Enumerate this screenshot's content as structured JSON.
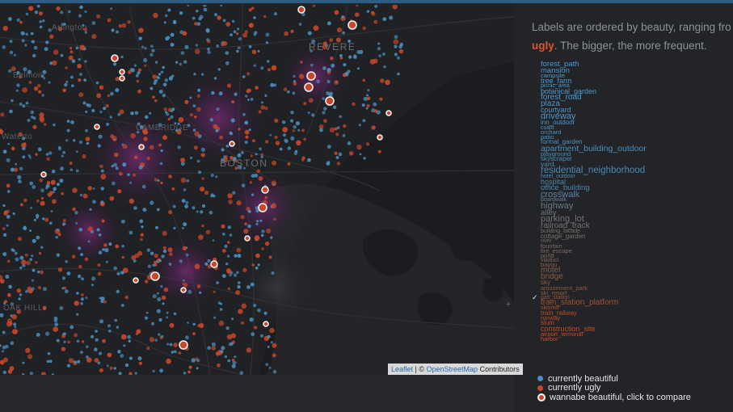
{
  "colors": {
    "beautiful": "#4a90c0",
    "ugly": "#c8472a",
    "wannabe_ring": "#f2f2f2",
    "heat": "#7a2a7a"
  },
  "map": {
    "places": [
      "Arlington",
      "Belmont",
      "Waterto",
      "REVERE",
      "BOSTON",
      "CAMBRIDGE",
      "OAK HILL"
    ],
    "attribution": {
      "leaflet": "Leaflet",
      "separator": " | © ",
      "osm": "OpenStreetMap",
      "suffix": " Contributors"
    },
    "zoom_mark": "+"
  },
  "panel": {
    "intro_line1": "Labels are ordered by beauty, ranging fro",
    "intro_ugly": "ugly",
    "intro_rest": ". The bigger, the more frequent.",
    "checkmark": "✓",
    "labels": [
      {
        "text": "forest_path",
        "size": 9.5,
        "color": "#4b9ad4"
      },
      {
        "text": "mansion",
        "size": 9.5,
        "color": "#4b9ad4"
      },
      {
        "text": "campsite",
        "size": 7.5,
        "color": "#4b9ad4"
      },
      {
        "text": "tree_farm",
        "size": 9,
        "color": "#4b9ad4"
      },
      {
        "text": "picnic_area",
        "size": 7,
        "color": "#4b9ad4"
      },
      {
        "text": "botanical_garden",
        "size": 9,
        "color": "#4b9ad4"
      },
      {
        "text": "forest_road",
        "size": 10,
        "color": "#4b9ad4"
      },
      {
        "text": "plaza",
        "size": 10,
        "color": "#4b96cc"
      },
      {
        "text": "courtyard",
        "size": 9,
        "color": "#4b96cc"
      },
      {
        "text": "driveway",
        "size": 11,
        "color": "#4b96cc"
      },
      {
        "text": "inn_outdoor",
        "size": 8,
        "color": "#4b94c8"
      },
      {
        "text": "coast",
        "size": 7,
        "color": "#4b94c8"
      },
      {
        "text": "orchard",
        "size": 7.5,
        "color": "#4b92c4"
      },
      {
        "text": "patio",
        "size": 7.5,
        "color": "#4b92c4"
      },
      {
        "text": "formal_garden",
        "size": 8,
        "color": "#4b90c0"
      },
      {
        "text": "apartment_building_outdoor",
        "size": 10.5,
        "color": "#4b90c0"
      },
      {
        "text": "playground",
        "size": 7.5,
        "color": "#4b8ebc"
      },
      {
        "text": "skyscraper",
        "size": 8,
        "color": "#4b8ebc"
      },
      {
        "text": "yard",
        "size": 8.5,
        "color": "#4b8cb8"
      },
      {
        "text": "residential_neighborhood",
        "size": 11.5,
        "color": "#4b8ab4"
      },
      {
        "text": "hotel_outdoor",
        "size": 7,
        "color": "#4b88b0"
      },
      {
        "text": "hospital",
        "size": 9,
        "color": "#4b86ac"
      },
      {
        "text": "office_building",
        "size": 9.5,
        "color": "#4b84a8"
      },
      {
        "text": "crosswalk",
        "size": 11,
        "color": "#5a82a0"
      },
      {
        "text": "boardwalk",
        "size": 7,
        "color": "#627e96"
      },
      {
        "text": "highway",
        "size": 11,
        "color": "#6a7a8a"
      },
      {
        "text": "alley",
        "size": 9.5,
        "color": "#707680"
      },
      {
        "text": "parking_lot",
        "size": 11,
        "color": "#747478"
      },
      {
        "text": "railroad_track",
        "size": 10,
        "color": "#767272"
      },
      {
        "text": "building_facade",
        "size": 7,
        "color": "#78706c"
      },
      {
        "text": "cottage_garden",
        "size": 8,
        "color": "#7a6e68"
      },
      {
        "text": "river",
        "size": 7,
        "color": "#7c6c64"
      },
      {
        "text": "fountain",
        "size": 7.5,
        "color": "#7e6a60"
      },
      {
        "text": "fire_escape",
        "size": 7.5,
        "color": "#80685c"
      },
      {
        "text": "pond",
        "size": 7.5,
        "color": "#826658"
      },
      {
        "text": "viaduct",
        "size": 7,
        "color": "#846454"
      },
      {
        "text": "bayou",
        "size": 7.5,
        "color": "#866250"
      },
      {
        "text": "motel",
        "size": 10,
        "color": "#88604c"
      },
      {
        "text": "bridge",
        "size": 10,
        "color": "#8a5e48"
      },
      {
        "text": "sky",
        "size": 8,
        "color": "#8c5c44"
      },
      {
        "text": "amusement_park",
        "size": 7.5,
        "color": "#905a40"
      },
      {
        "text": "ski_resort",
        "size": 7.5,
        "color": "#94583c"
      },
      {
        "text": "gas_station",
        "size": 7,
        "color": "#985638"
      },
      {
        "text": "train_station_platform",
        "size": 10,
        "color": "#a05234"
      },
      {
        "text": "skiomill",
        "size": 7,
        "color": "#a85030"
      },
      {
        "text": "train_railway",
        "size": 8,
        "color": "#b04e2e"
      },
      {
        "text": "runway",
        "size": 7.5,
        "color": "#b84c2c"
      },
      {
        "text": "slum",
        "size": 8,
        "color": "#c04a2a"
      },
      {
        "text": "construction_site",
        "size": 9,
        "color": "#c8482a"
      },
      {
        "text": "airport_terminal",
        "size": 7.5,
        "color": "#d04628"
      },
      {
        "text": "harbor",
        "size": 7.5,
        "color": "#d64428"
      }
    ],
    "legend": {
      "beautiful": "currently beautiful",
      "ugly": "currently ugly",
      "wannabe": "wannabe beautiful, click to compare"
    }
  }
}
